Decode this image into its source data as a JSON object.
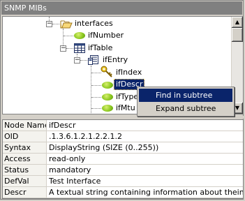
{
  "window": {
    "title": "SNMP MIBs"
  },
  "tree": {
    "nodes": [
      {
        "label": "interfaces",
        "icon": "folder-open-icon",
        "expanded": true
      },
      {
        "label": "ifNumber",
        "icon": "leaf-icon"
      },
      {
        "label": "ifTable",
        "icon": "table-icon",
        "expanded": true
      },
      {
        "label": "ifEntry",
        "icon": "entry-icon",
        "expanded": true
      },
      {
        "label": "ifIndex",
        "icon": "key-icon"
      },
      {
        "label": "ifDescr",
        "icon": "leaf-icon",
        "selected": true
      },
      {
        "label": "ifType",
        "icon": "leaf-icon"
      },
      {
        "label": "ifMtu",
        "icon": "leaf-icon"
      }
    ],
    "expand_glyph": "−"
  },
  "context_menu": {
    "items": [
      {
        "label": "Find in subtree",
        "active": true
      },
      {
        "label": "Expand subtree",
        "active": false
      }
    ]
  },
  "scrollbar": {
    "up_glyph": "▲",
    "down_glyph": "▼"
  },
  "properties": [
    {
      "key": "Node Name",
      "value": "ifDescr"
    },
    {
      "key": "OID",
      "value": ".1.3.6.1.2.1.2.2.1.2"
    },
    {
      "key": "Syntax",
      "value": "DisplayString (SIZE (0..255))"
    },
    {
      "key": "Access",
      "value": "read-only"
    },
    {
      "key": "Status",
      "value": "mandatory"
    },
    {
      "key": "DefVal",
      "value": "Test Interface"
    },
    {
      "key": "Descr",
      "value": "A textual string containing information about theinterfa..."
    }
  ],
  "colors": {
    "selection": "#0a246a",
    "leaf": "#8cc820",
    "titlebar": "#808080"
  }
}
